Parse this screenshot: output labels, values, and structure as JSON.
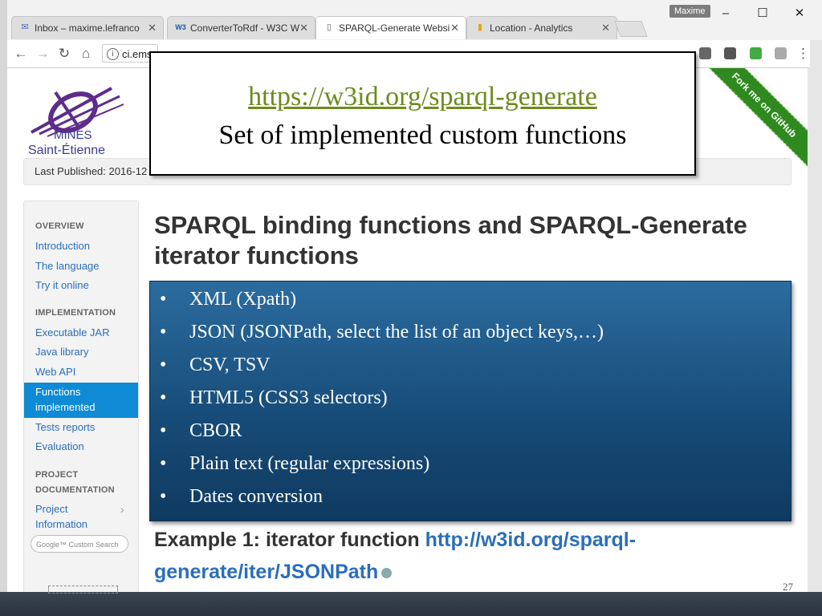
{
  "browser": {
    "tabs": [
      {
        "label": "Inbox – maxime.lefranco",
        "icon": "mail-icon"
      },
      {
        "label": "ConverterToRdf - W3C W",
        "icon": "w3c-icon"
      },
      {
        "label": "SPARQL-Generate Websi",
        "icon": "page-icon"
      },
      {
        "label": "Location - Analytics",
        "icon": "analytics-icon"
      }
    ],
    "profile": "Maxime",
    "address": "ci.emse.f"
  },
  "page": {
    "logo_line1": "MINES",
    "logo_line2": "Saint-Étienne",
    "published": "Last Published: 2016-12",
    "ribbon": "Fork me on GitHub",
    "sidebar": {
      "overview": "OVERVIEW",
      "introduction": "Introduction",
      "language": "The language",
      "try_online": "Try it online",
      "implementation": "IMPLEMENTATION",
      "executable_jar": "Executable JAR",
      "java_library": "Java library",
      "web_api": "Web API",
      "functions_1": "Functions",
      "functions_2": "implemented",
      "tests": "Tests reports",
      "evaluation": "Evaluation",
      "project": "PROJECT",
      "documentation": "DOCUMENTATION",
      "project_info_1": "Project",
      "project_info_2": "Information",
      "google_search": "Google™ Custom Search"
    },
    "heading": "SPARQL binding functions and SPARQL-Generate iterator functions",
    "example_prefix": "Example 1: iterator function ",
    "example_link": "http://w3id.org/sparql-generate/iter/JSONPath"
  },
  "slide": {
    "url": "https://w3id.org/sparql-generate",
    "subtitle": "Set of implemented custom functions",
    "bullets": [
      "XML (Xpath)",
      "JSON (JSONPath, select the list of an object keys,…)",
      "CSV, TSV",
      "HTML5 (CSS3 selectors)",
      "CBOR",
      "Plain text (regular expressions)",
      "Dates conversion"
    ],
    "bullet_char": "•",
    "page_number": "27"
  }
}
